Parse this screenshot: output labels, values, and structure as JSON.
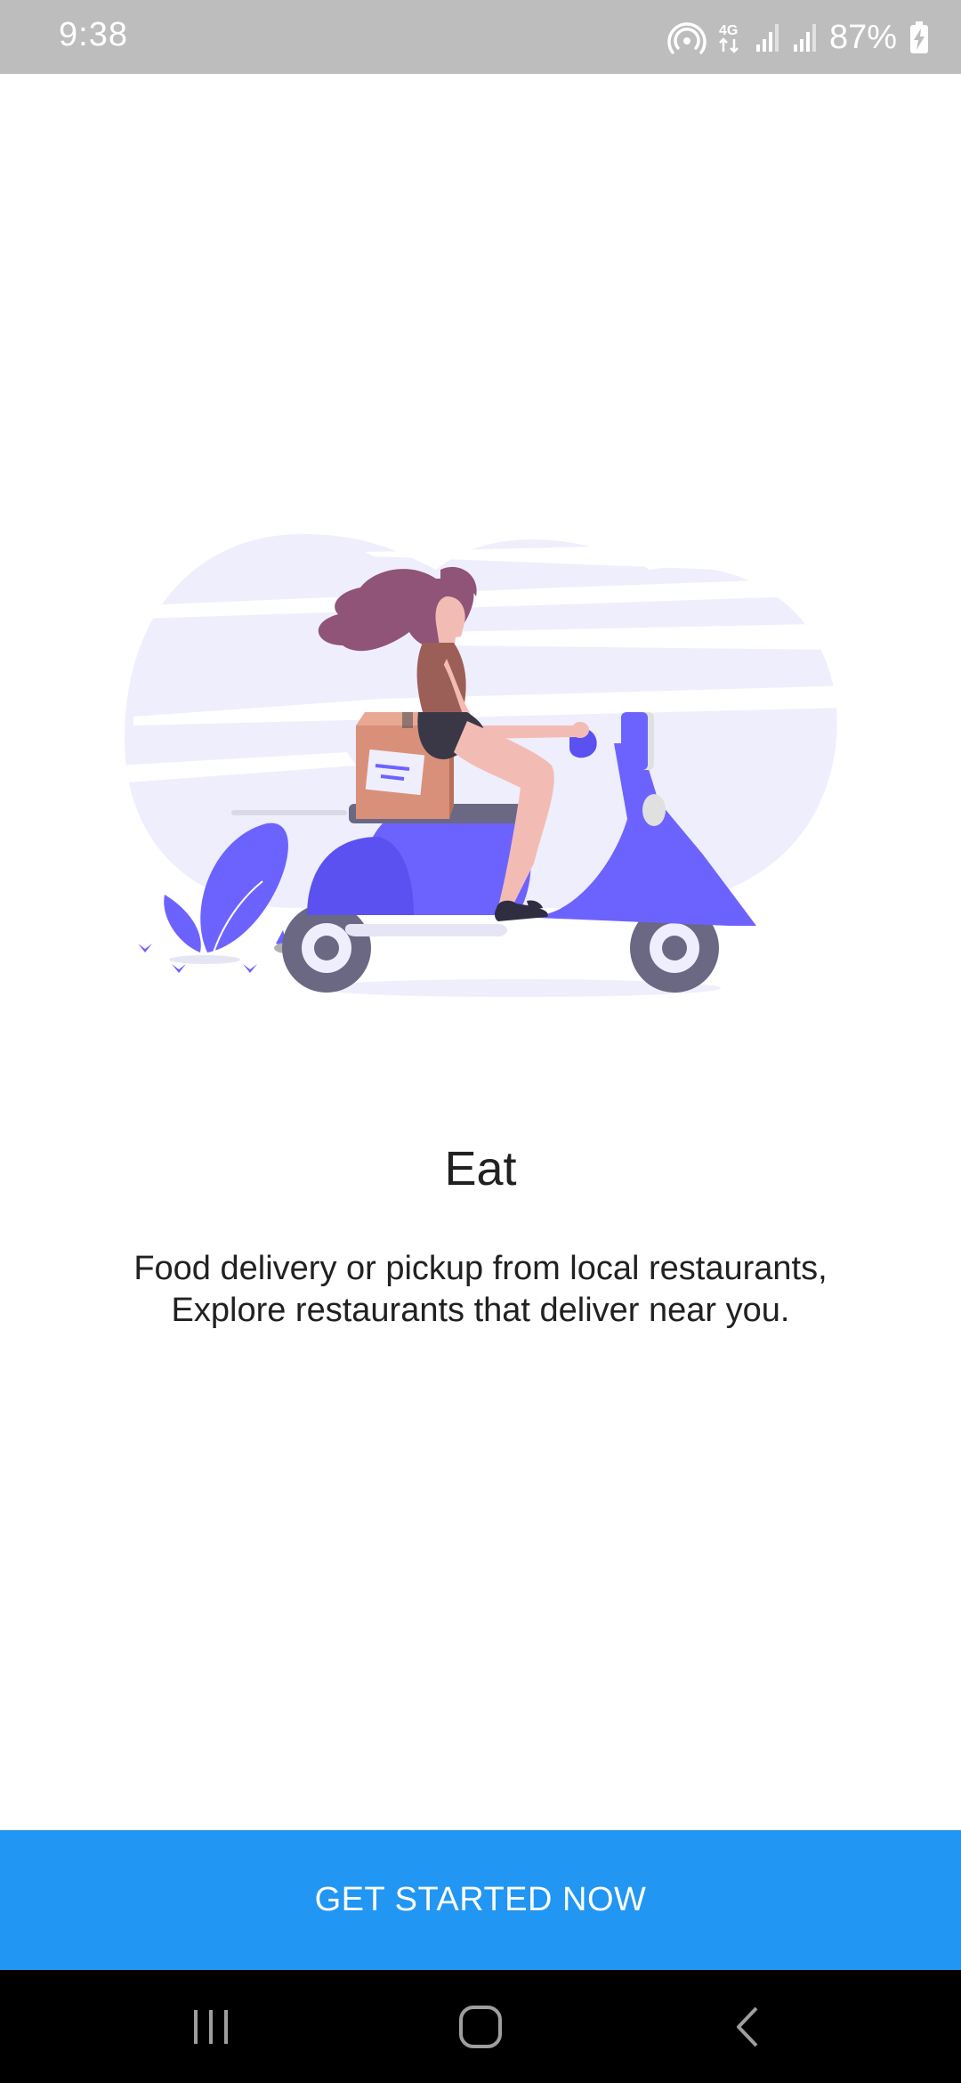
{
  "status_bar": {
    "time": "9:38",
    "battery_percent": "87%",
    "network_type": "4G",
    "icons": [
      "hotspot-icon",
      "network-4g-icon",
      "signal-icon",
      "signal-icon",
      "battery-charging-icon"
    ]
  },
  "onboarding": {
    "illustration": "woman-riding-scooter-delivering-box",
    "title": "Eat",
    "description_lines": [
      "Food delivery or pickup from local restaurants,",
      "Explore restaurants that deliver near you."
    ]
  },
  "cta": {
    "label": "GET STARTED NOW",
    "color": "#2196f3"
  },
  "nav_bar": {
    "icons": [
      "recent-apps-icon",
      "home-icon",
      "back-icon"
    ]
  },
  "colors": {
    "status_bar": "#bdbdbd",
    "accent": "#2196f3",
    "illustration_primary": "#6c63ff",
    "illustration_background": "#efeefc"
  }
}
